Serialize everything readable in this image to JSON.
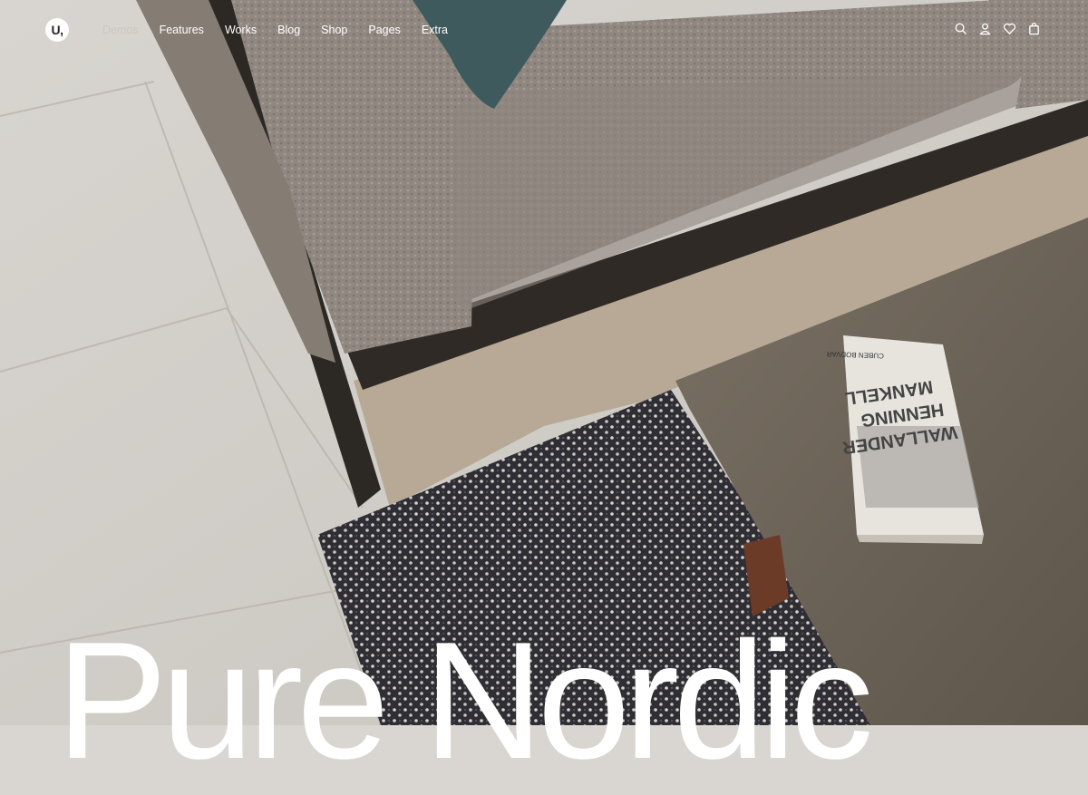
{
  "brand": {
    "logo_text": "U,"
  },
  "nav": {
    "items": [
      {
        "label": "Demos",
        "active": true
      },
      {
        "label": "Features"
      },
      {
        "label": "Works"
      },
      {
        "label": "Blog"
      },
      {
        "label": "Shop"
      },
      {
        "label": "Pages"
      },
      {
        "label": "Extra"
      }
    ]
  },
  "actions": {
    "icons": [
      "search-icon",
      "user-icon",
      "heart-icon",
      "shopping-bag-icon"
    ]
  },
  "hero": {
    "headline": "Pure Nordic",
    "book_cover": {
      "line1": "WALLANDER",
      "line2": "HENNING",
      "line3": "MANKELL",
      "top": "CUBEN BODVAR"
    }
  },
  "colors": {
    "text": "#ffffff",
    "muted_nav": "#c9c5c0",
    "sofa": "#8e857c",
    "table": "#6e6457",
    "floor": "#d4d1cc",
    "rug": "#2e2e33"
  }
}
